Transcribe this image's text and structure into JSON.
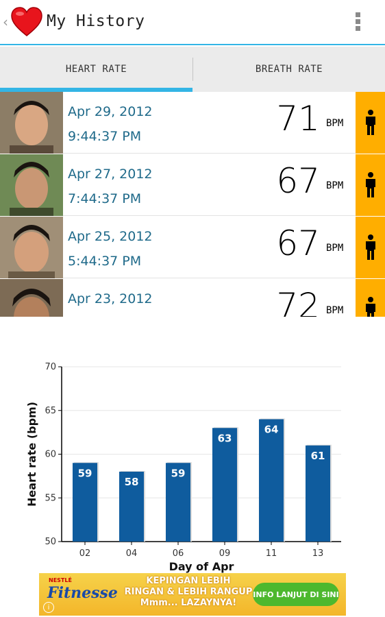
{
  "header": {
    "back_glyph": "‹",
    "title": "My History",
    "icon": "heart-icon",
    "overflow_icon": "overflow-menu-icon"
  },
  "tabs": [
    {
      "label": "HEART RATE",
      "selected": true
    },
    {
      "label": "BREATH RATE",
      "selected": false
    }
  ],
  "history": [
    {
      "date": "Apr 29, 2012",
      "time": "9:44:37 PM",
      "value": "71",
      "unit": "BPM",
      "status_icon": "person-icon"
    },
    {
      "date": "Apr 27, 2012",
      "time": "7:44:37 PM",
      "value": "67",
      "unit": "BPM",
      "status_icon": "person-icon"
    },
    {
      "date": "Apr 25, 2012",
      "time": "5:44:37 PM",
      "value": "67",
      "unit": "BPM",
      "status_icon": "person-icon"
    },
    {
      "date": "Apr 23, 2012",
      "time": "",
      "value": "72",
      "unit": "BPM",
      "status_icon": "person-icon"
    }
  ],
  "colors": {
    "accent": "#33b5e5",
    "status": "#ffae00",
    "bar": "#0f5c9e",
    "date_text": "#1f6a8a"
  },
  "chart_data": {
    "type": "bar",
    "categories": [
      "02",
      "04",
      "06",
      "09",
      "11",
      "13"
    ],
    "values": [
      59,
      58,
      59,
      63,
      64,
      61
    ],
    "xlabel": "Day of Apr",
    "ylabel": "Heart rate (bpm)",
    "ylim": [
      50,
      70
    ],
    "yticks": [
      50,
      55,
      60,
      65,
      70
    ],
    "grid": true,
    "data_labels": true
  },
  "ad": {
    "brand_top": "NESTLÉ",
    "brand": "Fitnesse",
    "line1": "KEPINGAN LEBIH",
    "line2": "RINGAN & LEBIH RANGUP",
    "line3": "Mmm... LAZAYNYA!",
    "cta": "INFO LANJUT DI SINI",
    "info_glyph": "i"
  }
}
